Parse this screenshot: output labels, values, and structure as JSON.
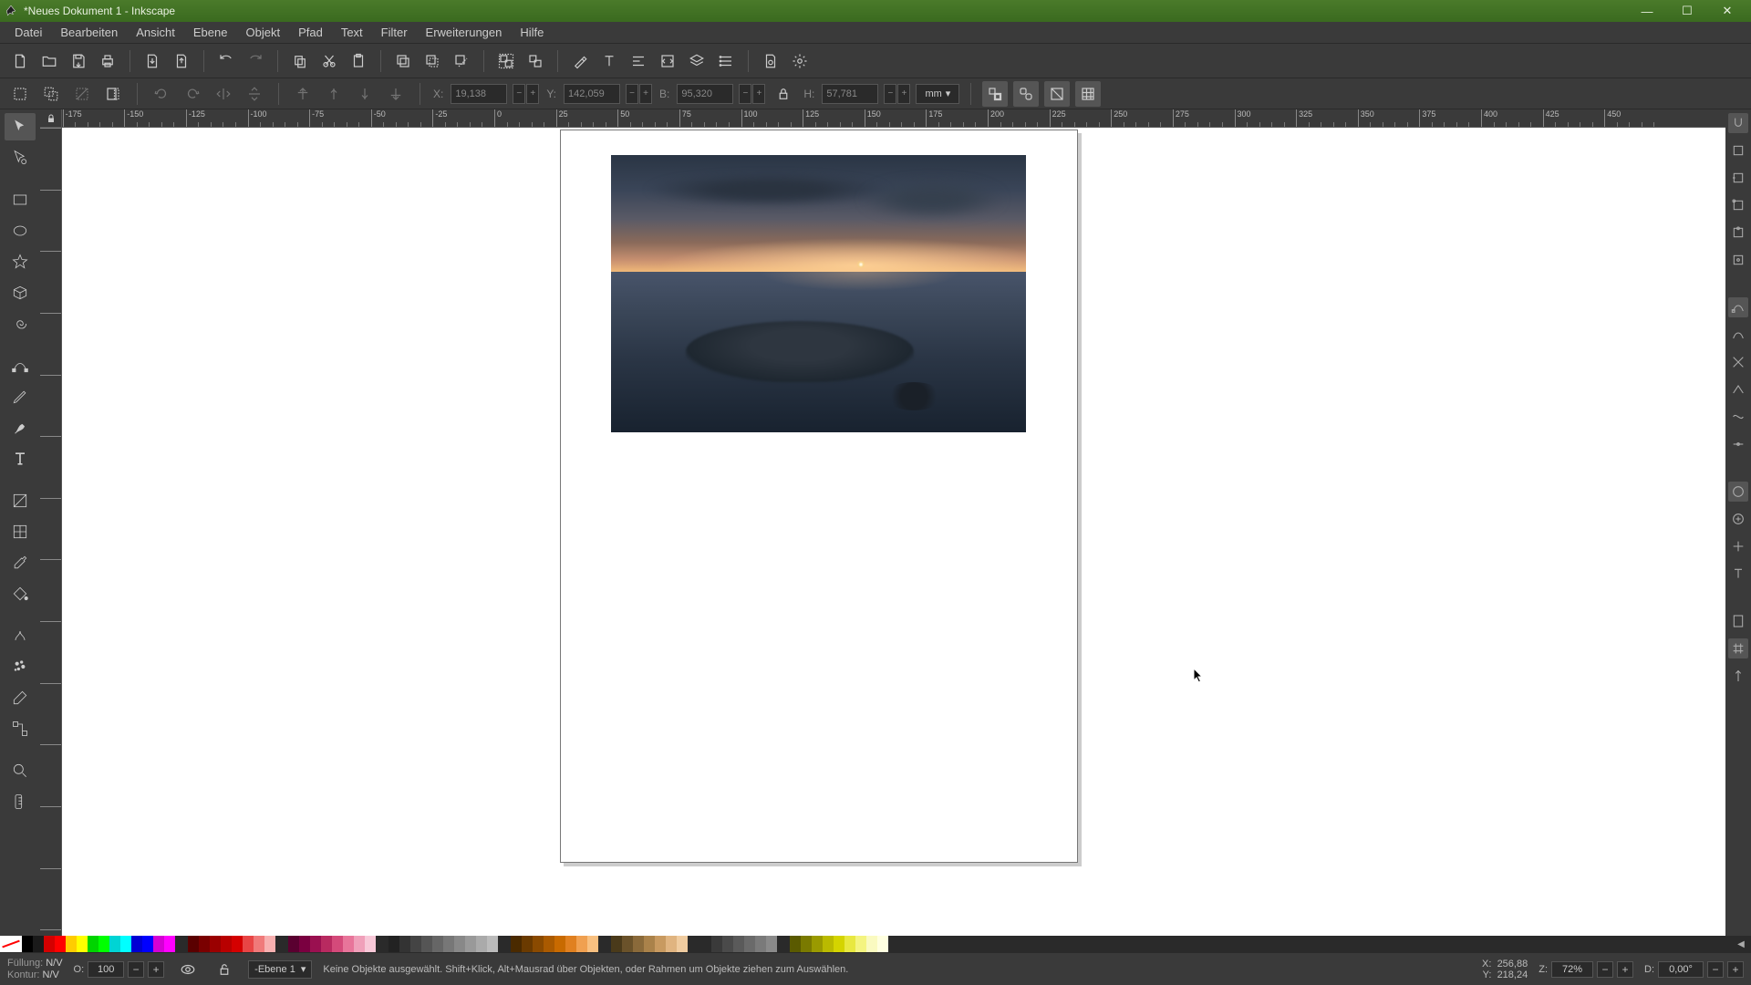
{
  "window": {
    "title": "*Neues Dokument 1 - Inkscape"
  },
  "menubar": [
    "Datei",
    "Bearbeiten",
    "Ansicht",
    "Ebene",
    "Objekt",
    "Pfad",
    "Text",
    "Filter",
    "Erweiterungen",
    "Hilfe"
  ],
  "toolcontrols": {
    "x_label": "X:",
    "x_value": "19,138",
    "y_label": "Y:",
    "y_value": "142,059",
    "w_label": "B:",
    "w_value": "95,320",
    "h_label": "H:",
    "h_value": "57,781",
    "unit": "mm"
  },
  "ruler_top_ticks": [
    -175,
    -150,
    -125,
    -100,
    -75,
    -50,
    -25,
    0,
    25,
    50,
    75,
    100,
    125,
    150,
    175,
    200,
    225,
    250,
    275,
    300,
    325,
    350,
    375,
    400,
    425,
    450
  ],
  "status": {
    "fill_label": "Füllung:",
    "fill_value": "N/V",
    "stroke_label": "Kontur:",
    "stroke_value": "N/V",
    "opacity_label": "O:",
    "opacity_value": "100",
    "layer_label": "-Ebene 1",
    "hint": "Keine Objekte ausgewählt. Shift+Klick, Alt+Mausrad über Objekten, oder Rahmen um Objekte ziehen zum Auswählen.",
    "coord_x_label": "X:",
    "coord_x": "256,88",
    "coord_y_label": "Y:",
    "coord_y": "218,24",
    "zoom_label": "Z:",
    "zoom_value": "72%",
    "rot_label": "D:",
    "rot_value": "0,00°"
  },
  "palette": {
    "base": [
      "#000000",
      "#1a1a1a",
      "#d40000",
      "#ff0000",
      "#ffcc00",
      "#ffff00",
      "#00d400",
      "#00ff00",
      "#00d4d4",
      "#00ffff",
      "#0000d4",
      "#0000ff",
      "#d400d4",
      "#ff00ff"
    ],
    "red_ramp": [
      "#5a0000",
      "#7a0000",
      "#9a0000",
      "#b80000",
      "#d40000",
      "#e84545",
      "#f07a7a",
      "#f8b0b0"
    ],
    "pink_ramp": [
      "#5a0030",
      "#7a0040",
      "#9a1050",
      "#b82a60",
      "#d44a7a",
      "#e8759a",
      "#f0a0ba",
      "#f8c8d8"
    ],
    "gray_ramp": [
      "#222",
      "#333",
      "#444",
      "#555",
      "#666",
      "#777",
      "#888",
      "#999",
      "#aaa",
      "#bbb"
    ],
    "orange_ramp": [
      "#4a2a00",
      "#6a3a00",
      "#8a4a00",
      "#aa5a00",
      "#c86a00",
      "#e08020",
      "#f0a050",
      "#f8c080"
    ],
    "tan_ramp": [
      "#4a3a1a",
      "#6a522a",
      "#8a6a3a",
      "#aa824a",
      "#c89a60",
      "#e0b480",
      "#f0cca0"
    ],
    "gray2_ramp": [
      "#2a2a2a",
      "#3a3a3a",
      "#4a4a4a",
      "#5a5a5a",
      "#6a6a6a",
      "#7a7a7a",
      "#8a8a8a"
    ],
    "yellow_ramp": [
      "#5a5a00",
      "#7a7a00",
      "#9a9a00",
      "#baba00",
      "#d4d400",
      "#e8e840",
      "#f4f480",
      "#fafac0",
      "#ffffe0"
    ]
  }
}
